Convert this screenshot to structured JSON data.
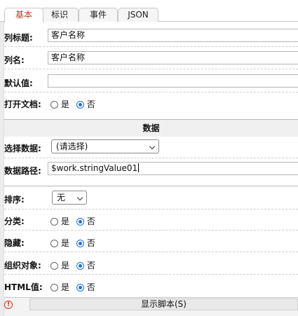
{
  "tabs": [
    {
      "label": "基本",
      "active": true
    },
    {
      "label": "标识",
      "active": false
    },
    {
      "label": "事件",
      "active": false
    },
    {
      "label": "JSON",
      "active": false
    }
  ],
  "fields": {
    "column_title": {
      "label": "列标题:",
      "value": "客户名称"
    },
    "column_name": {
      "label": "列名:",
      "value": "客户名称"
    },
    "default_value": {
      "label": "默认值:",
      "value": ""
    },
    "open_document": {
      "label": "打开文档:",
      "yes": "是",
      "no": "否",
      "selected": "no"
    }
  },
  "data_section": {
    "title": "数据",
    "select_data": {
      "label": "选择数据:",
      "value": "(请选择)"
    },
    "data_path": {
      "label": "数据路径:",
      "value": "$work.stringValue01"
    }
  },
  "options": {
    "sort": {
      "label": "排序:",
      "value": "无"
    },
    "category": {
      "label": "分类:",
      "yes": "是",
      "no": "否",
      "selected": "no"
    },
    "hidden": {
      "label": "隐藏:",
      "yes": "是",
      "no": "否",
      "selected": "no"
    },
    "group_object": {
      "label": "组织对象:",
      "yes": "是",
      "no": "否",
      "selected": "no"
    },
    "html_value": {
      "label": "HTML值:",
      "yes": "是",
      "no": "否",
      "selected": "no"
    }
  },
  "footer": {
    "show_script": "显示脚本(S)",
    "icon": "info-icon",
    "accent": "#d93025"
  },
  "colors": {
    "active_tab_text": "#c0392b",
    "radio_selected": "#1a73e8"
  }
}
